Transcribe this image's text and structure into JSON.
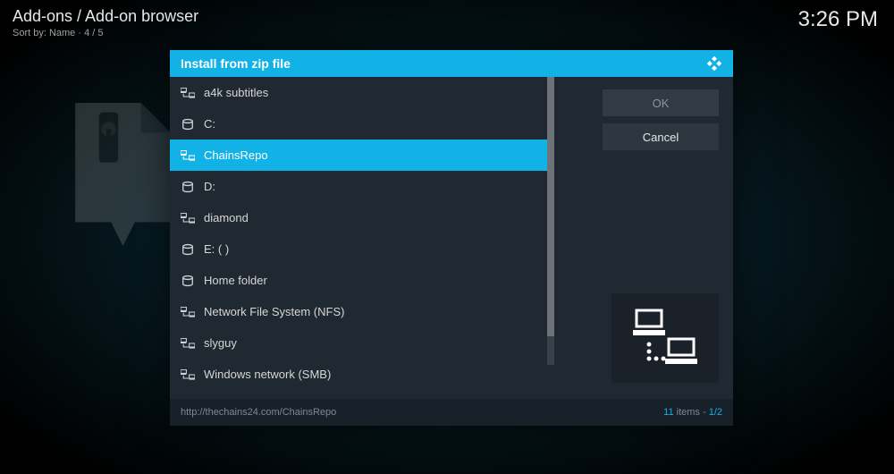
{
  "header": {
    "breadcrumb": "Add-ons / Add-on browser",
    "sort_label": "Sort by: Name",
    "position": "4 / 5"
  },
  "clock": "3:26 PM",
  "dialog": {
    "title": "Install from zip file",
    "items": [
      {
        "icon": "net",
        "label": "a4k subtitles",
        "selected": false
      },
      {
        "icon": "disk",
        "label": "C:",
        "selected": false
      },
      {
        "icon": "net",
        "label": "ChainsRepo",
        "selected": true
      },
      {
        "icon": "disk",
        "label": "D:",
        "selected": false
      },
      {
        "icon": "net",
        "label": "diamond",
        "selected": false
      },
      {
        "icon": "disk",
        "label": "E: ( )",
        "selected": false
      },
      {
        "icon": "disk",
        "label": "Home folder",
        "selected": false
      },
      {
        "icon": "net",
        "label": "Network File System (NFS)",
        "selected": false
      },
      {
        "icon": "net",
        "label": "slyguy",
        "selected": false
      },
      {
        "icon": "net",
        "label": "Windows network (SMB)",
        "selected": false
      }
    ],
    "buttons": {
      "ok": "OK",
      "cancel": "Cancel"
    },
    "footer": {
      "path": "http://thechains24.com/ChainsRepo",
      "count": "11",
      "count_label": " items - ",
      "page": "1/2"
    }
  }
}
